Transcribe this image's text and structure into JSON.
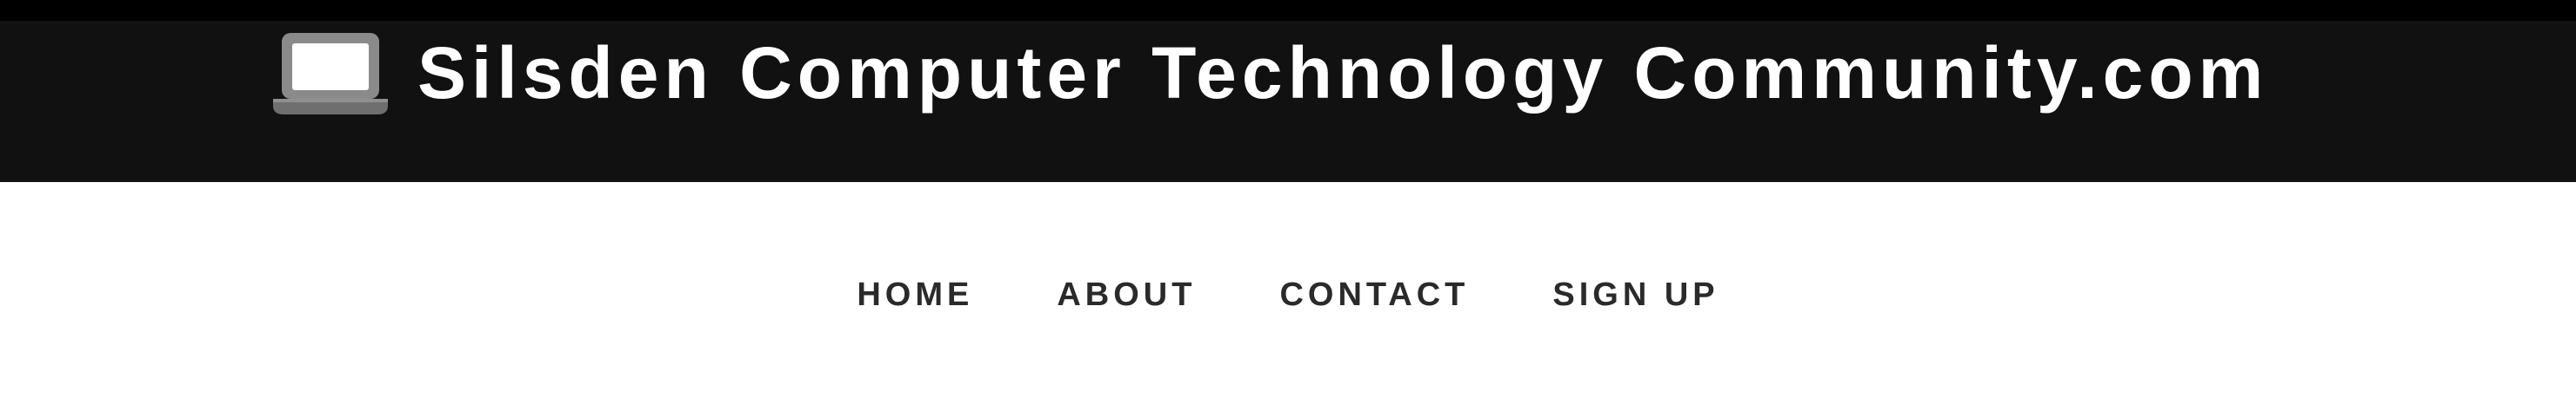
{
  "header": {
    "icon": "laptop-icon",
    "title": "Silsden Computer Technology Community.com",
    "background": "#111111",
    "title_color": "#ffffff"
  },
  "nav": {
    "items": [
      {
        "label": "HOME"
      },
      {
        "label": "ABOUT"
      },
      {
        "label": "CONTACT"
      },
      {
        "label": "SIGN UP"
      }
    ],
    "text_color": "#2a2a2a"
  }
}
